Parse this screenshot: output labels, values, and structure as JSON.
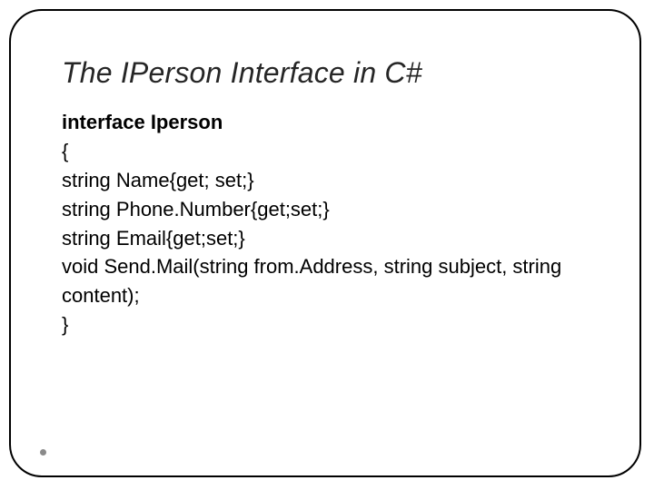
{
  "title": "The IPerson Interface in C#",
  "code": {
    "decl": "interface Iperson",
    "open": "{",
    "l1": "string Name{get; set;}",
    "l2": "string Phone.Number{get;set;}",
    "l3": "string Email{get;set;}",
    "l4": "void Send.Mail(string from.Address, string subject, string content);",
    "close": "}"
  }
}
